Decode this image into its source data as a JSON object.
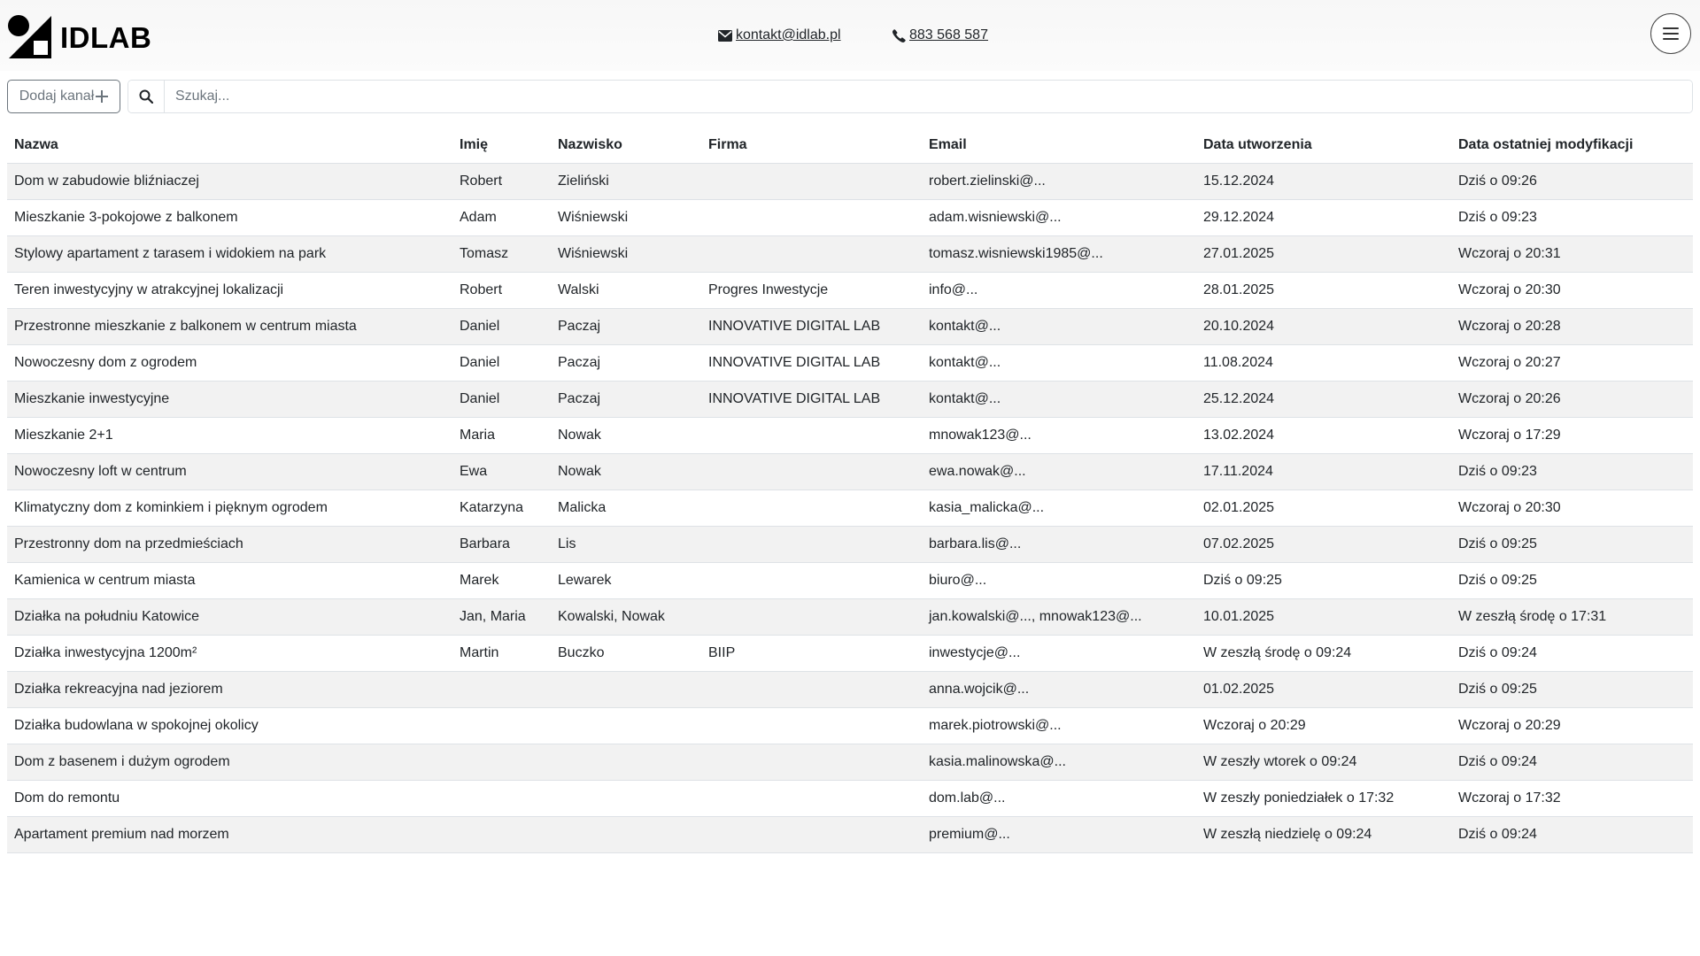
{
  "brand": {
    "name": "IDLAB"
  },
  "contact": {
    "email": "kontakt@idlab.pl",
    "phone": "883 568 587"
  },
  "toolbar": {
    "add_label": "Dodaj kanał",
    "search_placeholder": "Szukaj..."
  },
  "icons": {
    "email": "envelope-icon",
    "phone": "phone-icon",
    "menu": "hamburger-icon",
    "add": "plus-icon",
    "search": "search-icon"
  },
  "table": {
    "columns": [
      "Nazwa",
      "Imię",
      "Nazwisko",
      "Firma",
      "Email",
      "Data utworzenia",
      "Data ostatniej modyfikacji"
    ],
    "rows": [
      [
        "Dom w zabudowie bliźniaczej",
        "Robert",
        "Zieliński",
        "",
        "robert.zielinski@...",
        "15.12.2024",
        "Dziś o 09:26"
      ],
      [
        "Mieszkanie 3-pokojowe z balkonem",
        "Adam",
        "Wiśniewski",
        "",
        "adam.wisniewski@...",
        "29.12.2024",
        "Dziś o 09:23"
      ],
      [
        "Stylowy apartament z tarasem i widokiem na park",
        "Tomasz",
        "Wiśniewski",
        "",
        "tomasz.wisniewski1985@...",
        "27.01.2025",
        "Wczoraj o 20:31"
      ],
      [
        "Teren inwestycyjny w atrakcyjnej lokalizacji",
        "Robert",
        "Walski",
        "Progres Inwestycje",
        "info@...",
        "28.01.2025",
        "Wczoraj o 20:30"
      ],
      [
        "Przestronne mieszkanie z balkonem w centrum miasta",
        "Daniel",
        "Paczaj",
        "INNOVATIVE DIGITAL LAB",
        "kontakt@...",
        "20.10.2024",
        "Wczoraj o 20:28"
      ],
      [
        "Nowoczesny dom z ogrodem",
        "Daniel",
        "Paczaj",
        "INNOVATIVE DIGITAL LAB",
        "kontakt@...",
        "11.08.2024",
        "Wczoraj o 20:27"
      ],
      [
        "Mieszkanie inwestycyjne",
        "Daniel",
        "Paczaj",
        "INNOVATIVE DIGITAL LAB",
        "kontakt@...",
        "25.12.2024",
        "Wczoraj o 20:26"
      ],
      [
        "Mieszkanie 2+1",
        "Maria",
        "Nowak",
        "",
        "mnowak123@...",
        "13.02.2024",
        "Wczoraj o 17:29"
      ],
      [
        "Nowoczesny loft w centrum",
        "Ewa",
        "Nowak",
        "",
        "ewa.nowak@...",
        "17.11.2024",
        "Dziś o 09:23"
      ],
      [
        "Klimatyczny dom z kominkiem i pięknym ogrodem",
        "Katarzyna",
        "Malicka",
        "",
        "kasia_malicka@...",
        "02.01.2025",
        "Wczoraj o 20:30"
      ],
      [
        "Przestronny dom na przedmieściach",
        "Barbara",
        "Lis",
        "",
        "barbara.lis@...",
        "07.02.2025",
        "Dziś o 09:25"
      ],
      [
        "Kamienica w centrum miasta",
        "Marek",
        "Lewarek",
        "",
        "biuro@...",
        "Dziś o 09:25",
        "Dziś o 09:25"
      ],
      [
        "Działka na południu Katowice",
        "Jan, Maria",
        "Kowalski, Nowak",
        "",
        "jan.kowalski@..., mnowak123@...",
        "10.01.2025",
        "W zeszłą środę o 17:31"
      ],
      [
        "Działka inwestycyjna 1200m²",
        "Martin",
        "Buczko",
        "BIIP",
        "inwestycje@...",
        "W zeszłą środę o 09:24",
        "Dziś o 09:24"
      ],
      [
        "Działka rekreacyjna nad jeziorem",
        "",
        "",
        "",
        "anna.wojcik@...",
        "01.02.2025",
        "Dziś o 09:25"
      ],
      [
        "Działka budowlana w spokojnej okolicy",
        "",
        "",
        "",
        "marek.piotrowski@...",
        "Wczoraj o 20:29",
        "Wczoraj o 20:29"
      ],
      [
        "Dom z basenem i dużym ogrodem",
        "",
        "",
        "",
        "kasia.malinowska@...",
        "W zeszły wtorek o 09:24",
        "Dziś o 09:24"
      ],
      [
        "Dom do remontu",
        "",
        "",
        "",
        "dom.lab@...",
        "W zeszły poniedziałek o 17:32",
        "Wczoraj o 17:32"
      ],
      [
        "Apartament premium nad morzem",
        "",
        "",
        "",
        "premium@...",
        "W zeszłą niedzielę o 09:24",
        "Dziś o 09:24"
      ]
    ]
  }
}
